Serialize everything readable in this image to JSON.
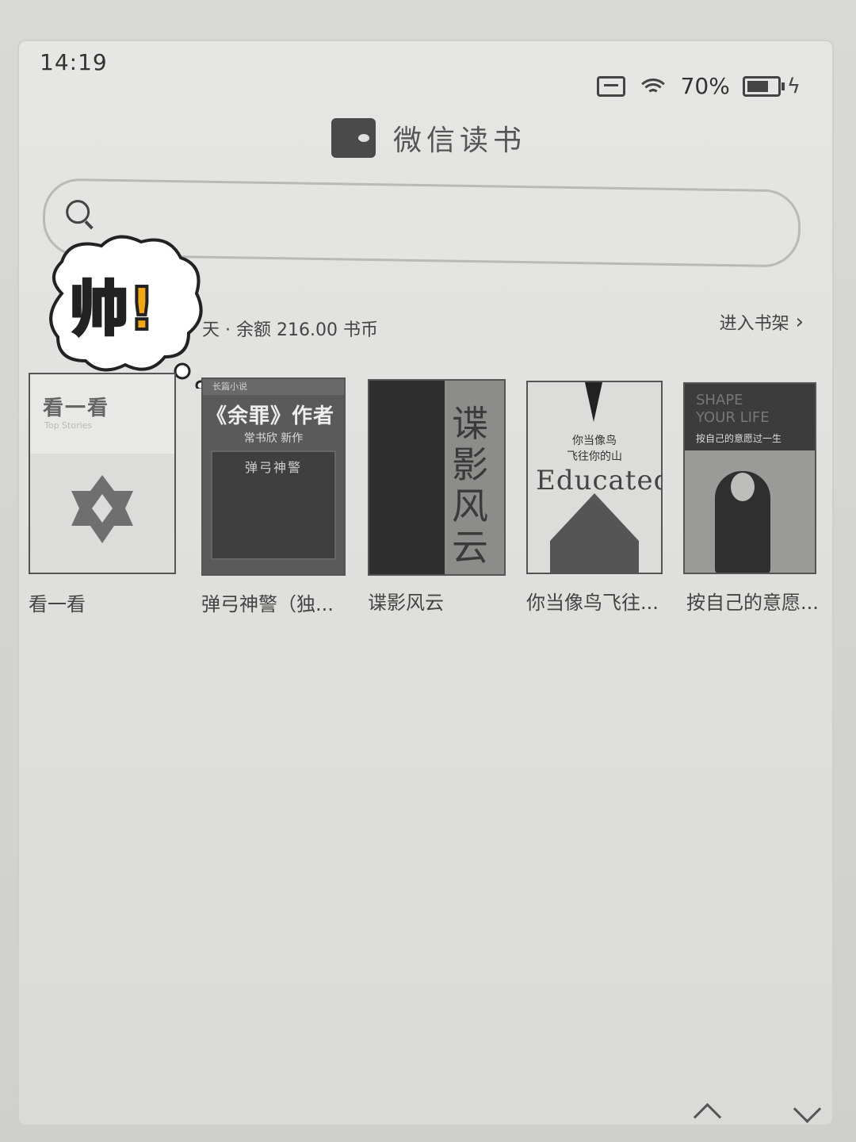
{
  "status_bar": {
    "time": "14:19",
    "battery_percent": "70%"
  },
  "header": {
    "app_title": "微信读书"
  },
  "account": {
    "summary": "天 · 余额 216.00 书币",
    "shelf_link": "进入书架"
  },
  "sticker": {
    "text": "帅!"
  },
  "books": [
    {
      "label": "看一看",
      "cover_title": "看一看",
      "cover_subtitle": "Top Stories"
    },
    {
      "label": "弹弓神警（独...",
      "cover_top": "长篇小说",
      "cover_title": "《余罪》作者",
      "cover_mid": "常书欣 新作",
      "cover_inner": "弹弓神警"
    },
    {
      "label": "谍影风云",
      "cover_title": "谍影风云"
    },
    {
      "label": "你当像鸟飞往...",
      "cover_cn": "你当像鸟\n飞往你的山",
      "cover_en": "Educated"
    },
    {
      "label": "按自己的意愿...",
      "cover_ghost": "SHAPE\nYOUR LIFE",
      "cover_text": "按自己的意愿过一生"
    }
  ]
}
